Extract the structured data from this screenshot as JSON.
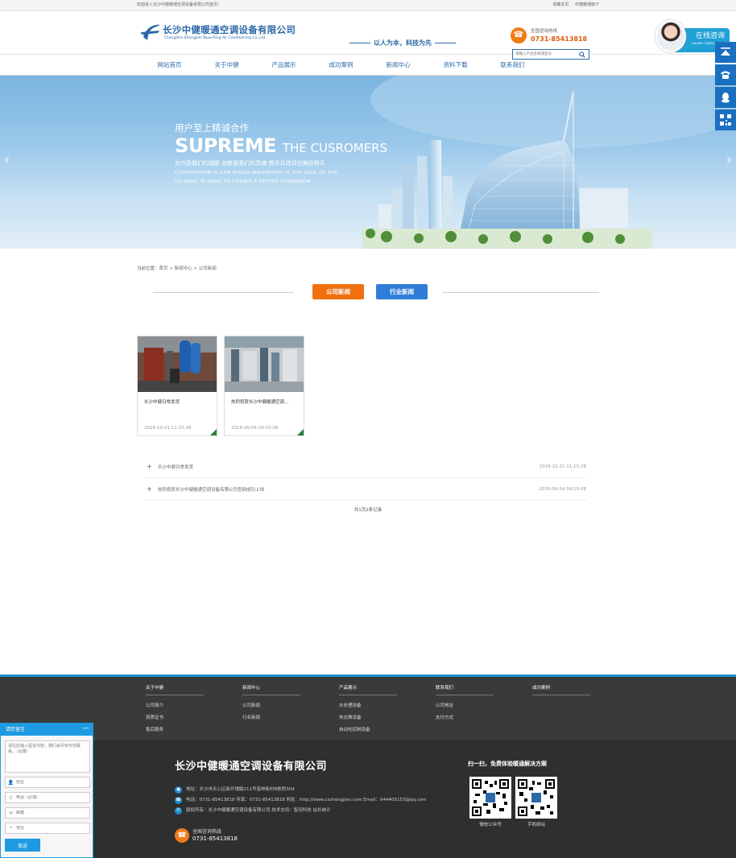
{
  "topbar": {
    "welcome": "欢迎进入长沙中健暖通空调设备有限公司首页!",
    "links": [
      "收藏本页",
      "中健暖通旗下"
    ]
  },
  "header": {
    "company_cn": "长沙中健暖通空调设备有限公司",
    "company_en": "ChangSha ZhongJian NuanTong Air Conditioning Co.,Ltd.",
    "slogan": "以人为本，科技为先",
    "hotline_label": "全国咨询热线",
    "hotline_number": "0731-85413818",
    "search_placeholder": "请输入产品名称或型号",
    "online_title": "在线咨询",
    "online_sub": "ONLINE CONSULTATION"
  },
  "nav": {
    "items": [
      "网站首页",
      "关于中健",
      "产品展示",
      "成功案例",
      "新闻中心",
      "资料下载",
      "联系我们"
    ]
  },
  "banner": {
    "line1": "用户至上精诚合作",
    "line2a": "SUPREME",
    "line2b": "THE CUSROMERS",
    "line3": "合作是我们的翅膀  创新是我们的灵魂  携手并进共创美好明天",
    "line4": "COOPERATION IS OUR WINGS INNOVATION IS THE SOUL OF THE",
    "line5": "US HAND IN HAND TO CREATE A BETTER TOMORROW",
    "prev": "‹",
    "next": "›"
  },
  "breadcrumb": "当前位置：首页 > 新闻中心 > 公司新闻",
  "tabs": [
    "公司新闻",
    "行业新闻"
  ],
  "cards": [
    {
      "title": "长沙中健日常发货",
      "date": "2016-10-21 11:15:28"
    },
    {
      "title": "热烈祝贺长沙中健暖通空调...",
      "date": "2016-06-04 09:15:08"
    }
  ],
  "news_list": [
    {
      "title": "长沙中健日常发货",
      "date": "2016-10-21 11:15:28"
    },
    {
      "title": "热烈祝贺长沙中健暖通空调设备有限公司官网成功上线",
      "date": "2016-06-04 09:15:08"
    }
  ],
  "pager": "共1页2条记录",
  "footer": {
    "columns": [
      {
        "heading": "关于中健",
        "items": [
          "公司简介",
          "资质证书",
          "售后服务"
        ]
      },
      {
        "heading": "新闻中心",
        "items": [
          "公司新闻",
          "行业新闻"
        ]
      },
      {
        "heading": "产品展示",
        "items": [
          "水处理设备",
          "热交换设备",
          "自动化控制设备"
        ]
      },
      {
        "heading": "联系我们",
        "items": [
          "公司地址",
          "支付方式"
        ]
      },
      {
        "heading": "成功案例",
        "items": []
      }
    ],
    "company": "长沙中健暖通空调设备有限公司",
    "address": "地址：长沙市天心区新开铺路211号富林新村B栋附304",
    "phone": "电话：0731-85413818   传真：0731-85413818   网址：http://www.cszhongjian.com   Email：644405153@qq.com",
    "copyright": "版权所有：长沙中健暖通空调设备有限公司   技术支持：智羽科技   站长统计",
    "hotline_label": "全国咨询热线",
    "hotline_number": "0731-85413818",
    "scan_title": "扫一扫，免费体验暖通解决方案",
    "qr1": "微信公众号",
    "qr2": "手机网站"
  },
  "message": {
    "title": "请您留言",
    "content_placeholder": "请在此输入留言内容，我们会尽快与您联系。（必填）",
    "name_placeholder": "姓名",
    "phone_placeholder": "电话（必填）",
    "email_placeholder": "邮箱",
    "address_placeholder": "地址",
    "send": "发送"
  }
}
